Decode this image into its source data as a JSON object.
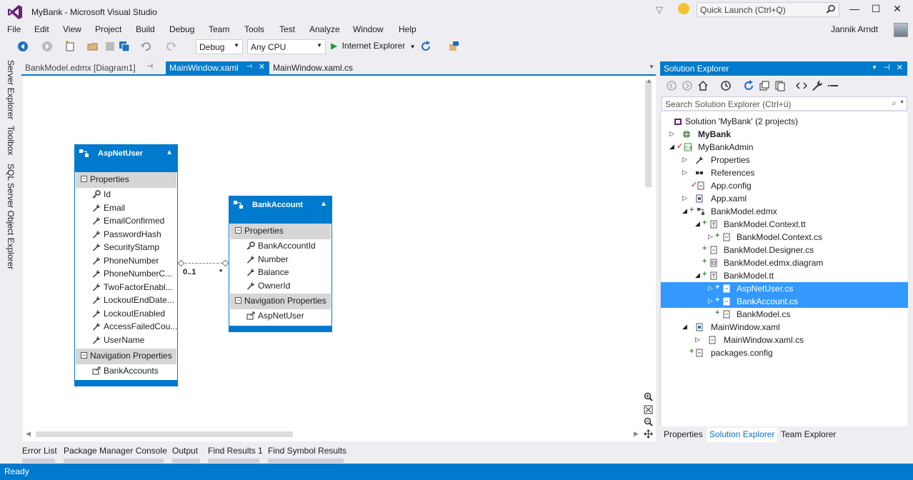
{
  "window": {
    "title": "MyBank - Microsoft Visual Studio",
    "quick_launch_placeholder": "Quick Launch (Ctrl+Q)",
    "user": "Jannik Arndt"
  },
  "menu": [
    "File",
    "Edit",
    "View",
    "Project",
    "Build",
    "Debug",
    "Team",
    "Tools",
    "Test",
    "Analyze",
    "Window",
    "Help"
  ],
  "toolbar": {
    "configuration": "Debug",
    "platform": "Any CPU",
    "run_target": "Internet Explorer"
  },
  "side_tabs": [
    "Server Explorer",
    "Toolbox",
    "SQL Server Object Explorer"
  ],
  "doc_tabs": [
    {
      "label": "BankModel.edmx [Diagram1]",
      "active": false
    },
    {
      "label": "MainWindow.xaml",
      "active": true
    },
    {
      "label": "MainWindow.xaml.cs",
      "active": false
    }
  ],
  "designer": {
    "entities": [
      {
        "name": "AspNetUser",
        "properties_label": "Properties",
        "properties": [
          "Id",
          "Email",
          "EmailConfirmed",
          "PasswordHash",
          "SecurityStamp",
          "PhoneNumber",
          "PhoneNumberC...",
          "TwoFactorEnabl...",
          "LockoutEndDate...",
          "LockoutEnabled",
          "AccessFailedCou...",
          "UserName"
        ],
        "nav_label": "Navigation Properties",
        "nav_properties": [
          "BankAccounts"
        ]
      },
      {
        "name": "BankAccount",
        "properties_label": "Properties",
        "properties": [
          "BankAccountId",
          "Number",
          "Balance",
          "OwnerId"
        ],
        "nav_label": "Navigation Properties",
        "nav_properties": [
          "AspNetUser"
        ]
      }
    ],
    "association": {
      "left_multiplicity": "0..1",
      "right_multiplicity": "*"
    }
  },
  "solution_explorer": {
    "title": "Solution Explorer",
    "search_placeholder": "Search Solution Explorer (Ctrl+ü)",
    "items": [
      {
        "label": "Solution 'MyBank' (2 projects)",
        "bold": false,
        "selected": false
      },
      {
        "label": "MyBank",
        "bold": true,
        "selected": false
      },
      {
        "label": "MyBankAdmin",
        "bold": false,
        "selected": false
      },
      {
        "label": "Properties",
        "bold": false,
        "selected": false
      },
      {
        "label": "References",
        "bold": false,
        "selected": false
      },
      {
        "label": "App.config",
        "bold": false,
        "selected": false
      },
      {
        "label": "App.xaml",
        "bold": false,
        "selected": false
      },
      {
        "label": "BankModel.edmx",
        "bold": false,
        "selected": false
      },
      {
        "label": "BankModel.Context.tt",
        "bold": false,
        "selected": false
      },
      {
        "label": "BankModel.Context.cs",
        "bold": false,
        "selected": false
      },
      {
        "label": "BankModel.Designer.cs",
        "bold": false,
        "selected": false
      },
      {
        "label": "BankModel.edmx.diagram",
        "bold": false,
        "selected": false
      },
      {
        "label": "BankModel.tt",
        "bold": false,
        "selected": false
      },
      {
        "label": "AspNetUser.cs",
        "bold": false,
        "selected": true
      },
      {
        "label": "BankAccount.cs",
        "bold": false,
        "selected": true
      },
      {
        "label": "BankModel.cs",
        "bold": false,
        "selected": false
      },
      {
        "label": "MainWindow.xaml",
        "bold": false,
        "selected": false
      },
      {
        "label": "MainWindow.xaml.cs",
        "bold": false,
        "selected": false
      },
      {
        "label": "packages.config",
        "bold": false,
        "selected": false
      }
    ],
    "bottom_tabs": [
      "Properties",
      "Solution Explorer",
      "Team Explorer"
    ]
  },
  "output_tabs": [
    "Error List",
    "Package Manager Console",
    "Output",
    "Find Results 1",
    "Find Symbol Results"
  ],
  "status": "Ready",
  "colors": {
    "accent": "#007ACC",
    "selection": "#3399FF",
    "chrome": "#EEEEF2"
  }
}
